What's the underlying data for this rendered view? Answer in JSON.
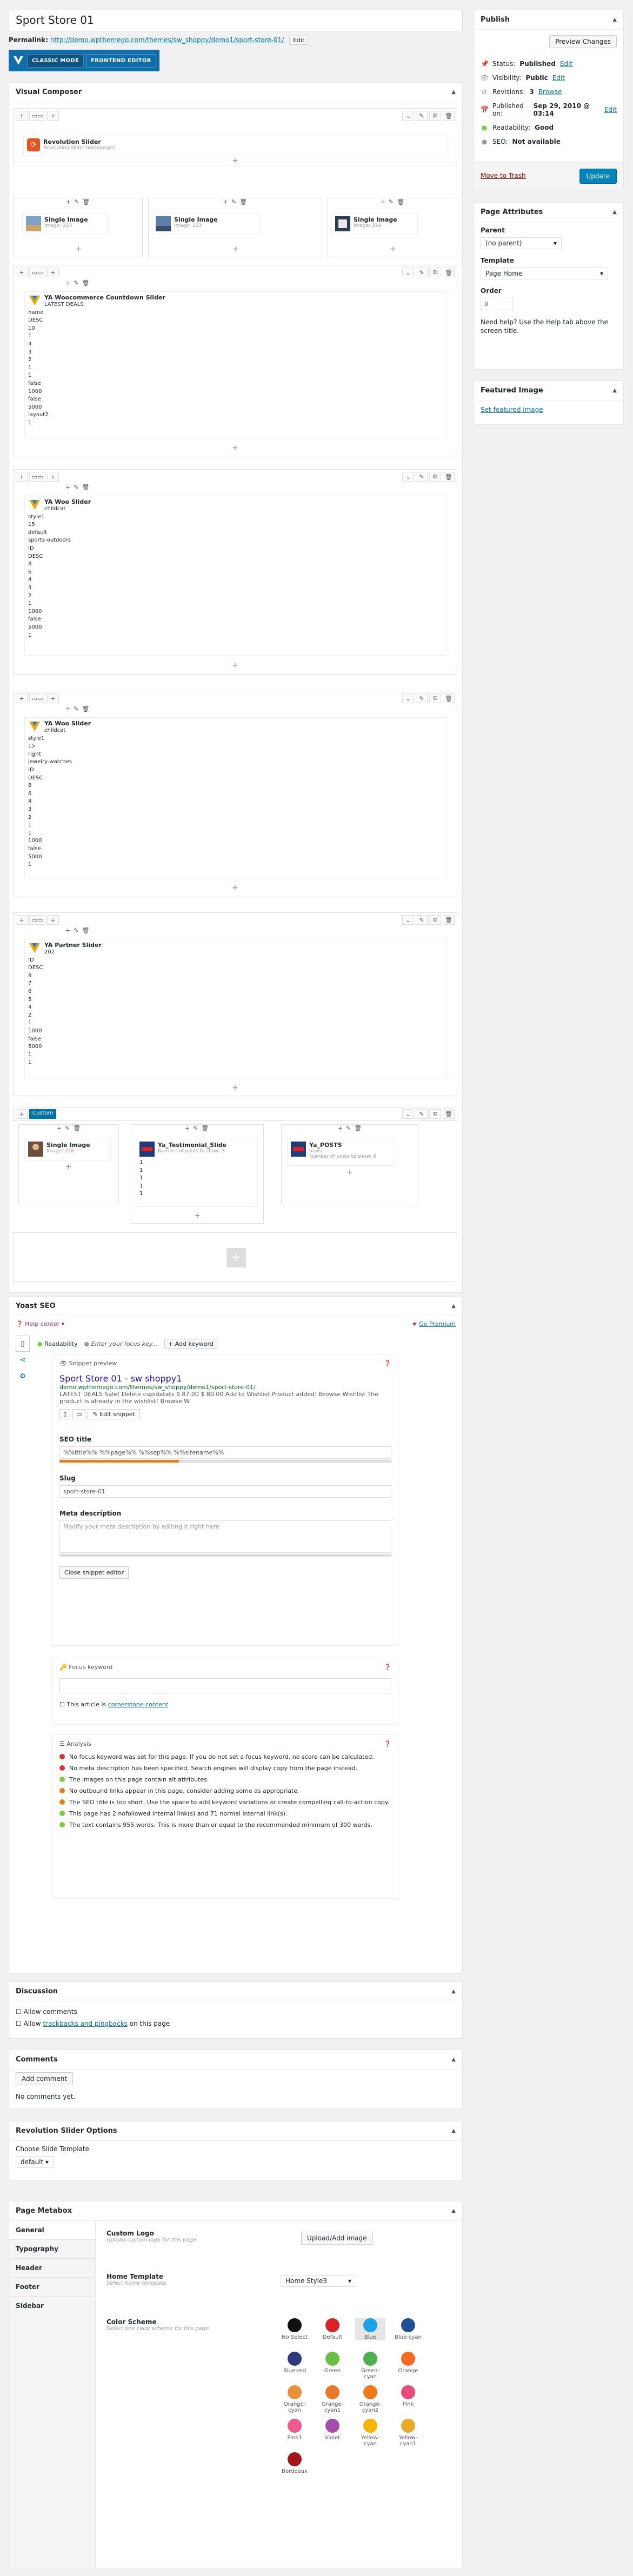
{
  "post": {
    "title": "Sport Store 01",
    "permalink_label": "Permalink:",
    "permalink_url": "http://demo.wpthemego.com/themes/sw_shoppy/demo1/sport-store-01/",
    "permalink_edit": "Edit"
  },
  "vc_mode": {
    "classic": "CLASSIC MODE",
    "frontend": "FRONTEND EDITOR"
  },
  "visual_composer": {
    "title": "Visual Composer",
    "rows": [
      {
        "elements": [
          {
            "title": "Revolution Slider",
            "sub": "Revolution Slider homepage2"
          }
        ]
      },
      {
        "elements": [
          {
            "title": "Single Image",
            "sub": "Image: 223"
          },
          {
            "title": "Single Image",
            "sub": "Image: 223"
          },
          {
            "title": "Single Image",
            "sub": "Image: 224"
          }
        ]
      },
      {
        "elements": [
          {
            "title": "YA Woocommerce Countdown Slider",
            "lines": [
              "LATEST DEALS",
              "name",
              "DESC",
              "10",
              "1",
              "4",
              "3",
              "2",
              "1",
              "1",
              "false",
              "1000",
              "false",
              "5000",
              "layout2",
              "1"
            ]
          }
        ]
      },
      {
        "elements": [
          {
            "title": "YA Woo Slider",
            "lines": [
              "childcat",
              "style1",
              "15",
              "default",
              "sports-outdoors",
              "ID",
              "DESC",
              "8",
              "6",
              "4",
              "3",
              "2",
              "1",
              "1000",
              "false",
              "5000",
              "1"
            ]
          }
        ]
      },
      {
        "elements": [
          {
            "title": "YA Woo Slider",
            "lines": [
              "childcat",
              "style1",
              "15",
              "right",
              "jewelry-watches",
              "ID",
              "DESC",
              "8",
              "6",
              "4",
              "3",
              "2",
              "1",
              "1",
              "1000",
              "false",
              "5000",
              "1"
            ]
          }
        ]
      },
      {
        "elements": [
          {
            "title": "YA Partner Slider",
            "lines": [
              "202",
              "ID",
              "DESC",
              "8",
              "7",
              "6",
              "5",
              "4",
              "2",
              "1",
              "1000",
              "false",
              "5000",
              "1",
              "1"
            ]
          }
        ]
      },
      {
        "tag": "Custom",
        "elements": [
          {
            "title": "Single Image",
            "sub": "Image: 226"
          },
          {
            "title": "Ya_Testimonial_Slide",
            "sub": "Number of posts to show: 3",
            "lines": [
              "1",
              "1",
              "1",
              "1",
              "1"
            ]
          },
          {
            "title": "Ya_POSTS",
            "sub": "news",
            "sub2": "Number of posts to show: 8"
          }
        ]
      }
    ]
  },
  "publish": {
    "title": "Publish",
    "preview": "Preview Changes",
    "status_label": "Status:",
    "status_value": "Published",
    "status_edit": "Edit",
    "visibility_label": "Visibility:",
    "visibility_value": "Public",
    "visibility_edit": "Edit",
    "revisions_label": "Revisions:",
    "revisions_value": "3",
    "revisions_browse": "Browse",
    "published_label": "Published on:",
    "published_value": "Sep 29, 2010 @ 03:14",
    "published_edit": "Edit",
    "readability_label": "Readability:",
    "readability_value": "Good",
    "seo_label": "SEO:",
    "seo_value": "Not available",
    "trash": "Move to Trash",
    "update": "Update"
  },
  "page_attributes": {
    "title": "Page Attributes",
    "parent_label": "Parent",
    "parent_value": "(no parent)",
    "template_label": "Template",
    "template_value": "Page Home",
    "order_label": "Order",
    "order_value": "0",
    "help": "Need help? Use the Help tab above the screen title."
  },
  "featured_image": {
    "title": "Featured Image",
    "link": "Set featured image"
  },
  "yoast": {
    "title": "Yoast SEO",
    "help_center": "Help center",
    "go_premium": "Go Premium",
    "tab_readability": "Readability",
    "tab_focus_placeholder": "Enter your focus key...",
    "add_keyword": "+ Add keyword",
    "snippet_heading": "Snippet preview",
    "snippet_title": "Sport Store 01 - sw shoppy1",
    "snippet_url": "demo.wpthemego.com/themes/sw_shoppy/demo1/sport-store-01/",
    "snippet_desc": "LATEST DEALS Sale! Delete cupidatats $ 87.00 $ 80.00 Add to Wishlist Product added! Browse Wishlist The product is already in the wishlist! Browse W",
    "edit_snippet": "Edit snippet",
    "seo_title_label": "SEO title",
    "seo_title_value": "%%title%% %%page%% %%sep%% %%sitename%%",
    "slug_label": "Slug",
    "slug_value": "sport-store-01",
    "meta_label": "Meta description",
    "meta_placeholder": "Modify your meta description by editing it right here",
    "close_editor": "Close snippet editor",
    "focus_heading": "Focus keyword",
    "cornerstone_text": "This article is",
    "cornerstone_link": "cornerstone content",
    "analysis_heading": "Analysis",
    "analysis": [
      {
        "color": "#dc3232",
        "text": "No focus keyword was set for this page. If you do not set a focus keyword, no score can be calculated."
      },
      {
        "color": "#dc3232",
        "text": "No meta description has been specified. Search engines will display copy from the page instead."
      },
      {
        "color": "#7ad03a",
        "text": "The images on this page contain alt attributes."
      },
      {
        "color": "#ee7c1b",
        "text": "No outbound links appear in this page, consider adding some as appropriate."
      },
      {
        "color": "#ee7c1b",
        "text": "The SEO title is too short. Use the space to add keyword variations or create compelling call-to-action copy."
      },
      {
        "color": "#7ad03a",
        "text": "This page has 2 nofollowed internal link(s) and 71 normal internal link(s)."
      },
      {
        "color": "#7ad03a",
        "text": "The text contains 955 words. This is more than or equal to the recommended minimum of 300 words."
      }
    ]
  },
  "discussion": {
    "title": "Discussion",
    "allow_comments": "Allow comments",
    "allow_prefix": "Allow",
    "trackbacks": "trackbacks and pingbacks",
    "allow_suffix": "on this page"
  },
  "comments": {
    "title": "Comments",
    "add": "Add comment",
    "none": "No comments yet."
  },
  "revslider": {
    "title": "Revolution Slider Options",
    "label": "Choose Slide Template",
    "value": "default"
  },
  "page_metabox": {
    "title": "Page Metabox",
    "tabs": [
      "General",
      "Typography",
      "Header",
      "Footer",
      "Sidebar"
    ],
    "custom_logo_label": "Custom Logo",
    "custom_logo_desc": "Upload custom logo for this page",
    "upload_btn": "Upload/Add image",
    "home_template_label": "Home Template",
    "home_template_desc": "Select home template",
    "home_template_value": "Home Style3",
    "color_scheme_label": "Color Scheme",
    "color_scheme_desc": "Select one color scheme for this page",
    "colors": [
      {
        "name": "No Select",
        "hex": "#111111"
      },
      {
        "name": "Default",
        "hex": "#d9222a"
      },
      {
        "name": "Blue",
        "hex": "#1aa3e8"
      },
      {
        "name": "Blue-cyan",
        "hex": "#1d4f91"
      },
      {
        "name": "Blue-red",
        "hex": "#2b3a7a"
      },
      {
        "name": "Green",
        "hex": "#6cbf43"
      },
      {
        "name": "Green-cyan",
        "hex": "#4caf50"
      },
      {
        "name": "Orange",
        "hex": "#f36c21"
      },
      {
        "name": "Orange-cyan",
        "hex": "#e8913a"
      },
      {
        "name": "Orange-cyan1",
        "hex": "#e97a2c"
      },
      {
        "name": "Orange-cyan2",
        "hex": "#f07a1a"
      },
      {
        "name": "Pink",
        "hex": "#e84c7d"
      },
      {
        "name": "Pink1",
        "hex": "#ef5b8c"
      },
      {
        "name": "Violet",
        "hex": "#a44fa9"
      },
      {
        "name": "Yellow-cyan",
        "hex": "#f4b400"
      },
      {
        "name": "Yellow-cyan1",
        "hex": "#e9a92a"
      },
      {
        "name": "Bordeaux",
        "hex": "#a0161b"
      }
    ]
  }
}
